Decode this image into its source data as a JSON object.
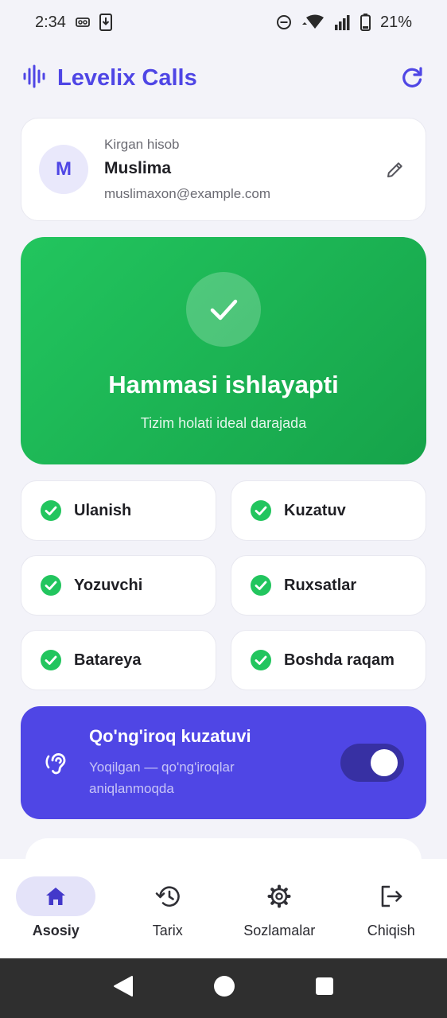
{
  "status_bar": {
    "time": "2:34",
    "battery": "21%"
  },
  "app": {
    "title": "Levelix Calls",
    "accent": "#4f46e5"
  },
  "account": {
    "caption": "Kirgan hisob",
    "avatar_letter": "M",
    "name": "Muslima",
    "email": "muslimaxon@example.com"
  },
  "status": {
    "title": "Hammasi ishlayapti",
    "subtitle": "Tizim holati ideal darajada",
    "color": "#22c55e"
  },
  "checks": [
    {
      "label": "Ulanish"
    },
    {
      "label": "Kuzatuv"
    },
    {
      "label": "Yozuvchi"
    },
    {
      "label": "Ruxsatlar"
    },
    {
      "label": "Batareya"
    },
    {
      "label": "Boshda raqam"
    }
  ],
  "monitoring": {
    "title": "Qo'ng'iroq kuzatuvi",
    "subtitle": "Yoqilgan — qo'ng'iroqlar aniqlanmoqda",
    "enabled": true
  },
  "nav": [
    {
      "label": "Asosiy",
      "icon": "home-icon",
      "active": true
    },
    {
      "label": "Tarix",
      "icon": "history-icon",
      "active": false
    },
    {
      "label": "Sozlamalar",
      "icon": "gear-icon",
      "active": false
    },
    {
      "label": "Chiqish",
      "icon": "logout-icon",
      "active": false
    }
  ]
}
